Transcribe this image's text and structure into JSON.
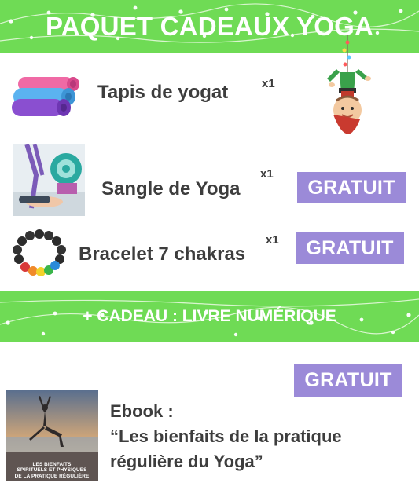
{
  "header": {
    "title": "PAQUET CADEAUX YOGA"
  },
  "items": [
    {
      "name": "Tapis de yogat",
      "qty": "x1",
      "badge": "",
      "image_icon": "yoga-mat-icon"
    },
    {
      "name": "Sangle de Yoga",
      "qty": "x1",
      "badge": "GRATUIT",
      "image_icon": "yoga-strap-icon"
    },
    {
      "name": "Bracelet 7 chakras",
      "qty": "x1",
      "badge": "GRATUIT",
      "image_icon": "chakra-bracelet-icon"
    }
  ],
  "gift_banner": {
    "text": "+ CADEAU : LIVRE NUMÉRIQUE"
  },
  "ebook": {
    "badge": "GRATUIT",
    "label": "Ebook :",
    "title_line1": "“Les bienfaits de la pratique",
    "title_line2": "régulière du Yoga”",
    "cover_line1": "LES BIENFAITS",
    "cover_line2": "SPIRITUELS ET PHYSIQUES",
    "cover_line3": "DE LA PRATIQUE RÉGULIÈRE"
  },
  "colors": {
    "banner_green": "#6fdb55",
    "badge_purple": "#9b8ad8",
    "text_dark": "#3d3d3d"
  },
  "decorations": [
    "string-lights-icon",
    "elf-icon"
  ]
}
